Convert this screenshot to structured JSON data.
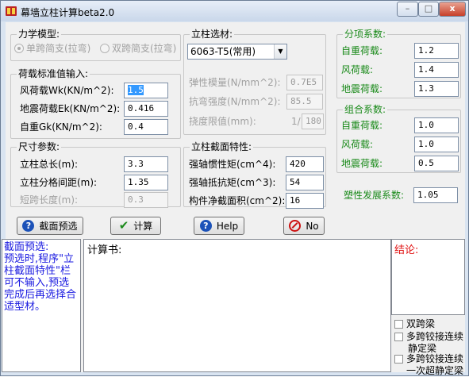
{
  "window": {
    "title": "幕墙立柱计算beta2.0",
    "controls": {
      "minimize": "–",
      "maximize": "□",
      "close": "x"
    }
  },
  "mechanics": {
    "legend": "力学模型:",
    "option1": "单跨简支(拉弯)",
    "option2": "双跨简支(拉弯)",
    "selected": "option1"
  },
  "loads": {
    "legend": "荷载标准值输入:",
    "wind_label": "风荷载Wk(KN/m^2):",
    "wind_value": "1.5",
    "quake_label": "地震荷载Ek(KN/m^2):",
    "quake_value": "0.416",
    "dead_label": "自重Gk(KN/m^2):",
    "dead_value": "0.4"
  },
  "dimensions": {
    "legend": "尺寸参数:",
    "total_label": "立柱总长(m):",
    "total_value": "3.3",
    "spacing_label": "立柱分格间距(m):",
    "spacing_value": "1.35",
    "short_label": "短跨长度(m):",
    "short_value": "0.3"
  },
  "material": {
    "legend": "立柱选材:",
    "selected": "6063-T5(常用)",
    "modulus_label": "弹性模量(N/mm^2):",
    "modulus_value": "0.7E5",
    "strength_label": "抗弯强度(N/mm^2):",
    "strength_value": "85.5",
    "deflection_label": "挠度限值(mm):",
    "deflection_prefix": "1/",
    "deflection_value": "180"
  },
  "section": {
    "legend": "立柱截面特性:",
    "inertia_label": "强轴惯性矩(cm^4):",
    "inertia_value": "420",
    "modulus_label": "强轴抵抗矩(cm^3):",
    "modulus_value": "54",
    "area_label": "构件净截面积(cm^2):",
    "area_value": "16"
  },
  "partial_factors": {
    "legend": "分项系数:",
    "dead_label": "自重荷载:",
    "dead_value": "1.2",
    "wind_label": "风荷载:",
    "wind_value": "1.4",
    "quake_label": "地震荷载:",
    "quake_value": "1.3"
  },
  "combo_factors": {
    "legend": "组合系数:",
    "dead_label": "自重荷载:",
    "dead_value": "1.0",
    "wind_label": "风荷载:",
    "wind_value": "1.0",
    "quake_label": "地震荷载:",
    "quake_value": "0.5"
  },
  "plastic": {
    "label": "塑性发展系数:",
    "value": "1.05"
  },
  "buttons": {
    "preview": "截面预选",
    "calculate": "计算",
    "help": "Help",
    "no": "No"
  },
  "notes": {
    "text": "截面预选:\n预选时,程序\"立柱截面特性\"栏可不输入,预选完成后再选择合适型材。"
  },
  "report": {
    "title": "计算书:"
  },
  "conclusion": {
    "title": "结论:"
  },
  "options": {
    "opt1": "双跨梁",
    "opt2_l1": "多跨铰接连续",
    "opt2_l2": "静定梁",
    "opt3_l1": "多跨铰接连续",
    "opt3_l2": "一次超静定梁"
  },
  "colors": {
    "blue_text": "#1a1ae0",
    "red_text": "#e01010",
    "green_text": "#1a8a1a",
    "selection": "#3399ff"
  }
}
